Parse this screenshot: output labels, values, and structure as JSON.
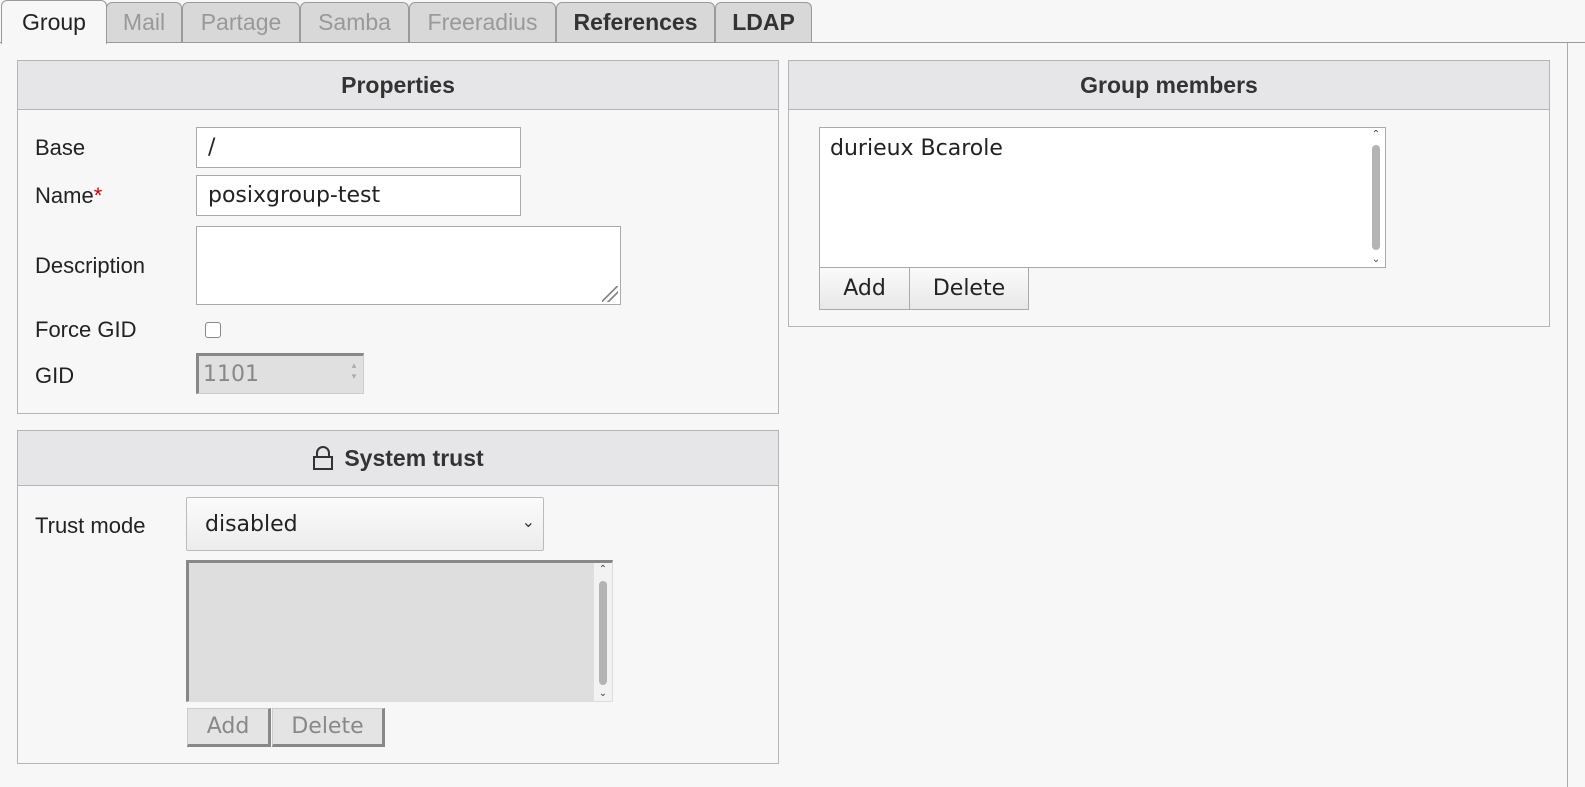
{
  "tabs": [
    {
      "label": "Group",
      "state": "active"
    },
    {
      "label": "Mail",
      "state": "disabled"
    },
    {
      "label": "Partage",
      "state": "disabled"
    },
    {
      "label": "Samba",
      "state": "disabled"
    },
    {
      "label": "Freeradius",
      "state": "disabled"
    },
    {
      "label": "References",
      "state": "enabled"
    },
    {
      "label": "LDAP",
      "state": "enabled"
    }
  ],
  "properties": {
    "title": "Properties",
    "base_label": "Base",
    "base_value": "/",
    "name_label": "Name",
    "name_required": "*",
    "name_value": "posixgroup-test",
    "description_label": "Description",
    "description_value": "",
    "force_gid_label": "Force GID",
    "force_gid_checked": false,
    "gid_label": "GID",
    "gid_value": "1101"
  },
  "system_trust": {
    "title": "System trust",
    "icon": "lock-icon",
    "trust_mode_label": "Trust mode",
    "trust_mode_value": "disabled",
    "add_label": "Add",
    "delete_label": "Delete"
  },
  "group_members": {
    "title": "Group members",
    "members": [
      "durieux Bcarole"
    ],
    "add_label": "Add",
    "delete_label": "Delete"
  },
  "colors": {
    "required": "#cc0000",
    "panel_header": "#e6e6e8",
    "page_background": "#f7f7f7"
  }
}
